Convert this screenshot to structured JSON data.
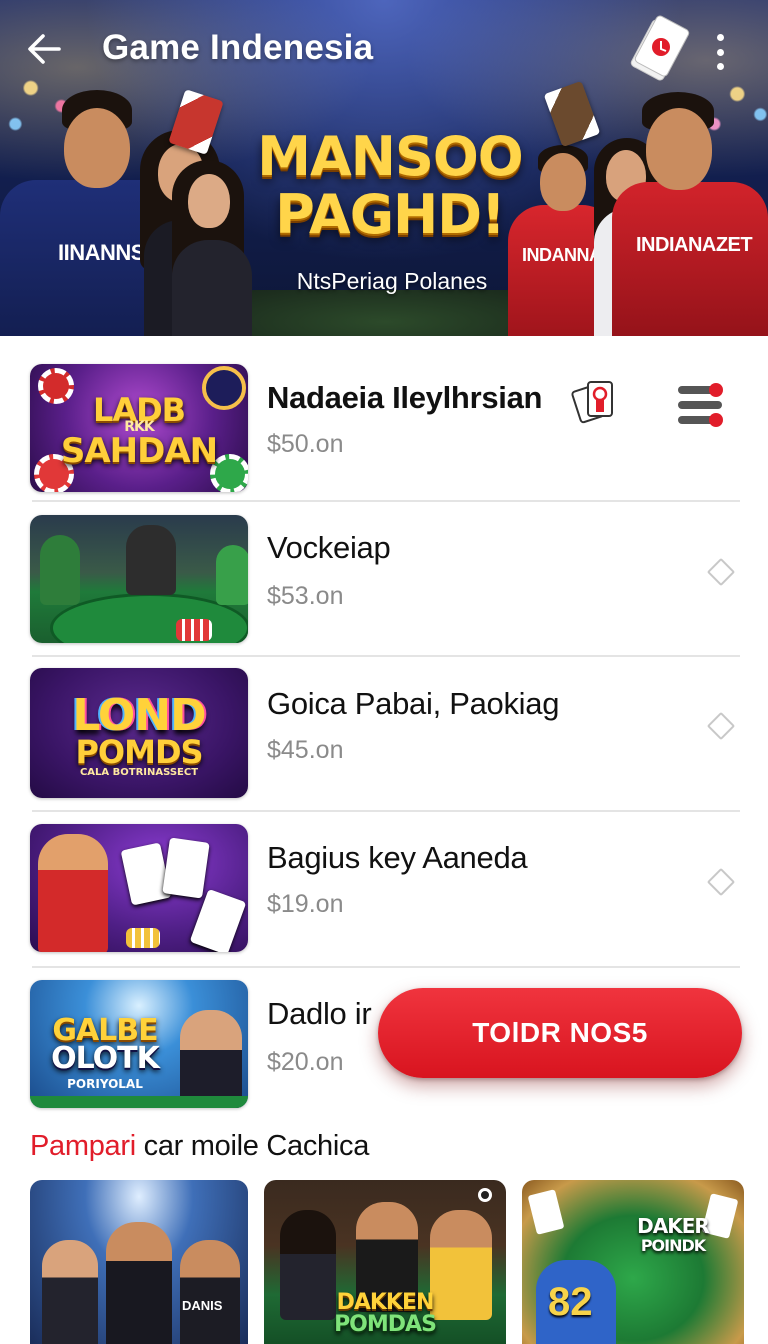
{
  "header": {
    "title": "Game Indenesia",
    "headline_line1": "MANSOO",
    "headline_line2": "PAGHD!",
    "subtitle": "NtsPeriag Polanes",
    "left_jersey": "IINANNSEI",
    "right_jersey_1": "INDANNA",
    "right_jersey_2": "INDIANAZET",
    "icons": {
      "back": "arrow-left-icon",
      "menu": "more-vertical-icon",
      "badge": "playing-card-icon"
    }
  },
  "games": [
    {
      "name": "Nadaeia Ileylhrsian",
      "price": "50.on",
      "thumb_line1": "LADB",
      "thumb_small": "RKK",
      "thumb_line2": "SAHDAN"
    },
    {
      "name": "Vockeiap",
      "price": "53.on"
    },
    {
      "name": "Goica Pabai, Paokiag",
      "price": "45.on",
      "thumb_line1": "LOND",
      "thumb_line2": "POMDS",
      "thumb_small": "CALA BOTRINASSECT"
    },
    {
      "name": "Bagius key Aaneda",
      "price": "19.on"
    },
    {
      "name": "Dadlo ir",
      "price": "20.on",
      "thumb_line1": "GALBE",
      "thumb_line2": "OLOTK",
      "thumb_small": "PORIYOLAL"
    }
  ],
  "fab": {
    "label": "TOlDR NOS5"
  },
  "section": {
    "accent": "Pampari",
    "rest": " car moile Cachica"
  },
  "promos": [
    {
      "label": "DANIS"
    },
    {
      "label_line1": "DAKKEN",
      "label_line2": "POMDAS"
    },
    {
      "label_line1": "DAKER",
      "label_line2": "POINDK",
      "number": "82"
    }
  ],
  "colors": {
    "accent": "#e11d2a",
    "fab": "#e2202b",
    "hero_bg": "#132052",
    "headline": "#ffd54a"
  }
}
